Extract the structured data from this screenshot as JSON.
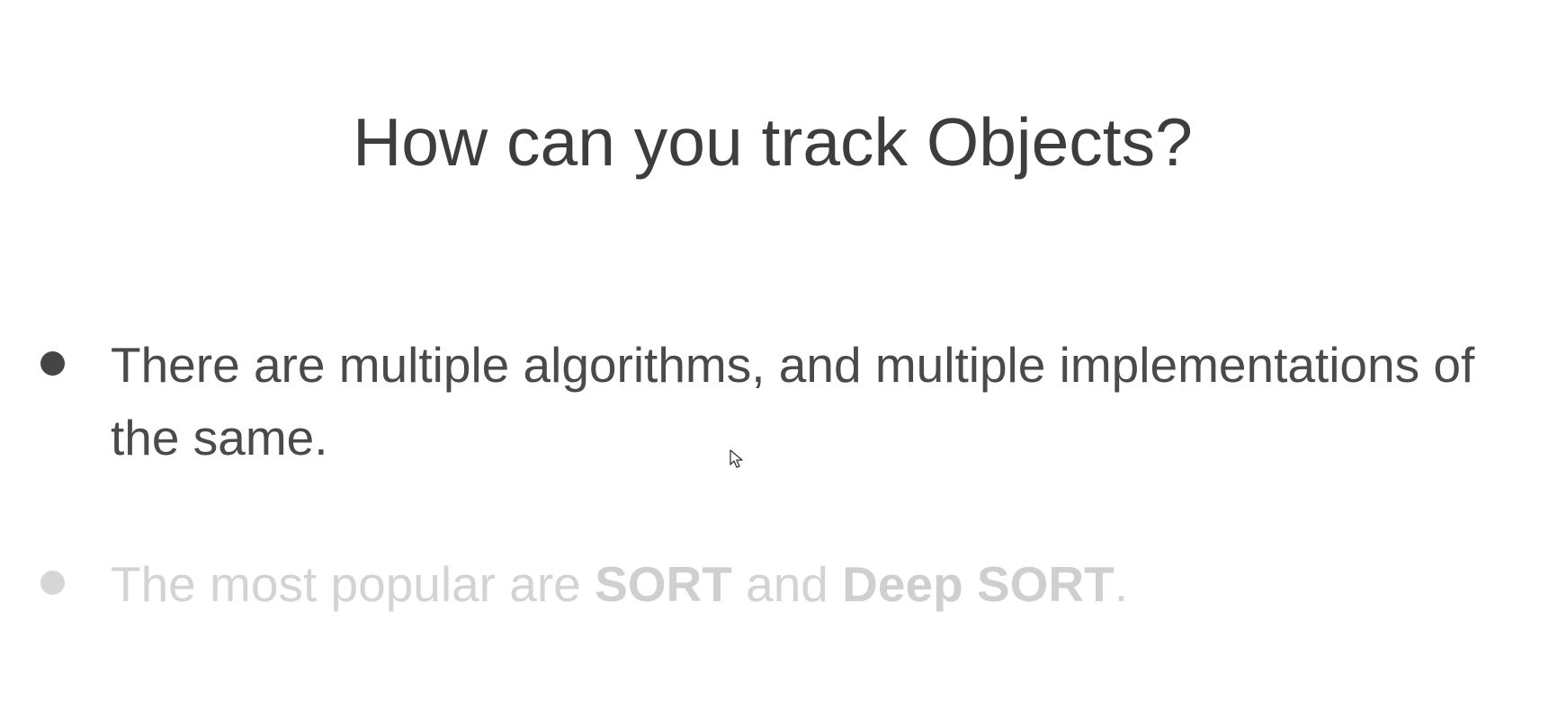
{
  "slide": {
    "title": "How can you track Objects?",
    "bullets": [
      {
        "text": "There are multiple algorithms, and multiple implementations of the same."
      },
      {
        "part1": "The most popular are ",
        "strong1": "SORT",
        "part2": " and ",
        "strong2": "Deep SORT",
        "part3": "."
      }
    ]
  },
  "cursor": {
    "icon": "mouse-pointer-icon"
  },
  "colors": {
    "title": "#3d3d3d",
    "active_text": "#4a4a4a",
    "faded_text": "#d3d3d3",
    "background": "#ffffff"
  }
}
